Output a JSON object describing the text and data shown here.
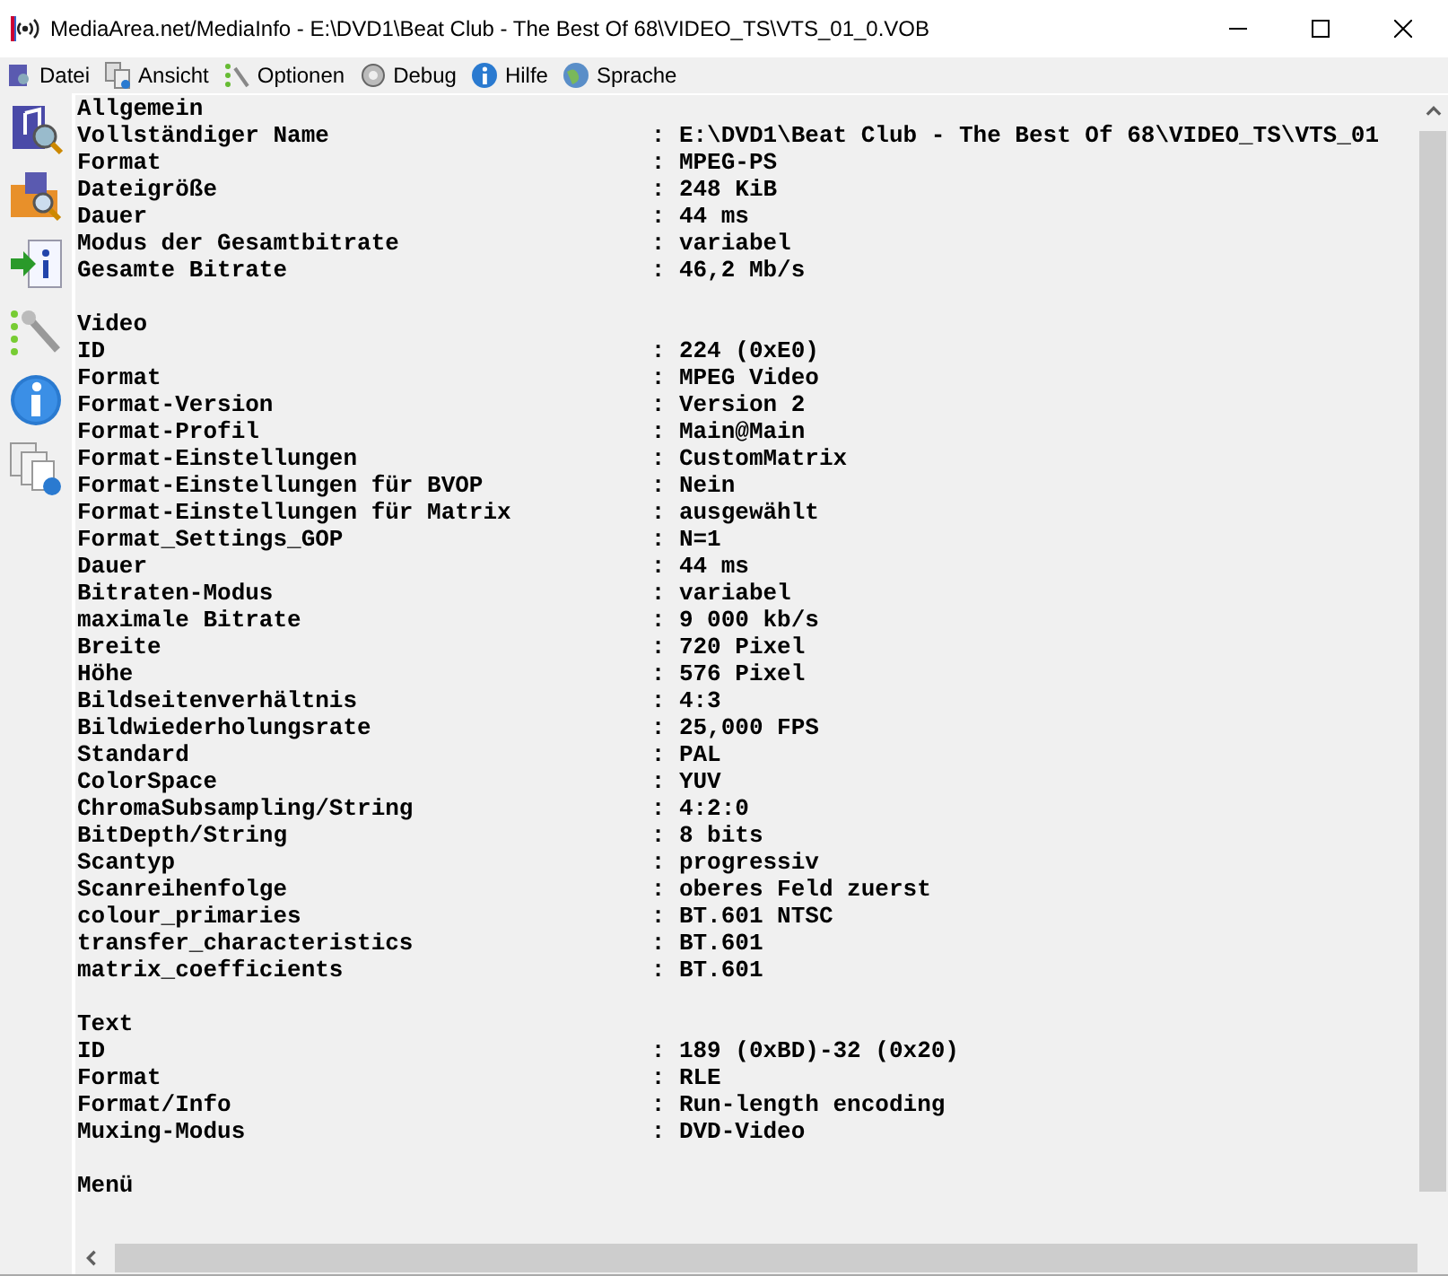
{
  "window": {
    "title": "MediaArea.net/MediaInfo - E:\\DVD1\\Beat Club - The Best Of 68\\VIDEO_TS\\VTS_01_0.VOB"
  },
  "menu": [
    {
      "label": "Datei"
    },
    {
      "label": "Ansicht"
    },
    {
      "label": "Optionen"
    },
    {
      "label": "Debug"
    },
    {
      "label": "Hilfe"
    },
    {
      "label": "Sprache"
    }
  ],
  "sections": [
    {
      "title": "Allgemein",
      "fields": [
        {
          "label": "Vollständiger Name",
          "value": ": E:\\DVD1\\Beat Club - The Best Of 68\\VIDEO_TS\\VTS_01"
        },
        {
          "label": "Format",
          "value": ": MPEG-PS"
        },
        {
          "label": "Dateigröße",
          "value": ": 248 KiB"
        },
        {
          "label": "Dauer",
          "value": ": 44 ms"
        },
        {
          "label": "Modus der Gesamtbitrate",
          "value": ": variabel"
        },
        {
          "label": "Gesamte Bitrate",
          "value": ": 46,2 Mb/s"
        }
      ]
    },
    {
      "title": "Video",
      "fields": [
        {
          "label": "ID",
          "value": ": 224 (0xE0)"
        },
        {
          "label": "Format",
          "value": ": MPEG Video"
        },
        {
          "label": "Format-Version",
          "value": ": Version 2"
        },
        {
          "label": "Format-Profil",
          "value": ": Main@Main"
        },
        {
          "label": "Format-Einstellungen",
          "value": ": CustomMatrix"
        },
        {
          "label": "Format-Einstellungen für BVOP",
          "value": ": Nein"
        },
        {
          "label": "Format-Einstellungen für Matrix",
          "value": ": ausgewählt"
        },
        {
          "label": "Format_Settings_GOP",
          "value": ": N=1"
        },
        {
          "label": "Dauer",
          "value": ": 44 ms"
        },
        {
          "label": "Bitraten-Modus",
          "value": ": variabel"
        },
        {
          "label": "maximale Bitrate",
          "value": ": 9 000 kb/s"
        },
        {
          "label": "Breite",
          "value": ": 720 Pixel"
        },
        {
          "label": "Höhe",
          "value": ": 576 Pixel"
        },
        {
          "label": "Bildseitenverhältnis",
          "value": ": 4:3"
        },
        {
          "label": "Bildwiederholungsrate",
          "value": ": 25,000 FPS"
        },
        {
          "label": "Standard",
          "value": ": PAL"
        },
        {
          "label": "ColorSpace",
          "value": ": YUV"
        },
        {
          "label": "ChromaSubsampling/String",
          "value": ": 4:2:0"
        },
        {
          "label": "BitDepth/String",
          "value": ": 8 bits"
        },
        {
          "label": "Scantyp",
          "value": ": progressiv"
        },
        {
          "label": "Scanreihenfolge",
          "value": ": oberes Feld zuerst"
        },
        {
          "label": "colour_primaries",
          "value": ": BT.601 NTSC"
        },
        {
          "label": "transfer_characteristics",
          "value": ": BT.601"
        },
        {
          "label": "matrix_coefficients",
          "value": ": BT.601"
        }
      ]
    },
    {
      "title": "Text",
      "fields": [
        {
          "label": "ID",
          "value": ": 189 (0xBD)-32 (0x20)"
        },
        {
          "label": "Format",
          "value": ": RLE"
        },
        {
          "label": "Format/Info",
          "value": ": Run-length encoding"
        },
        {
          "label": "Muxing-Modus",
          "value": ": DVD-Video"
        }
      ]
    },
    {
      "title": "Menü"
    }
  ]
}
